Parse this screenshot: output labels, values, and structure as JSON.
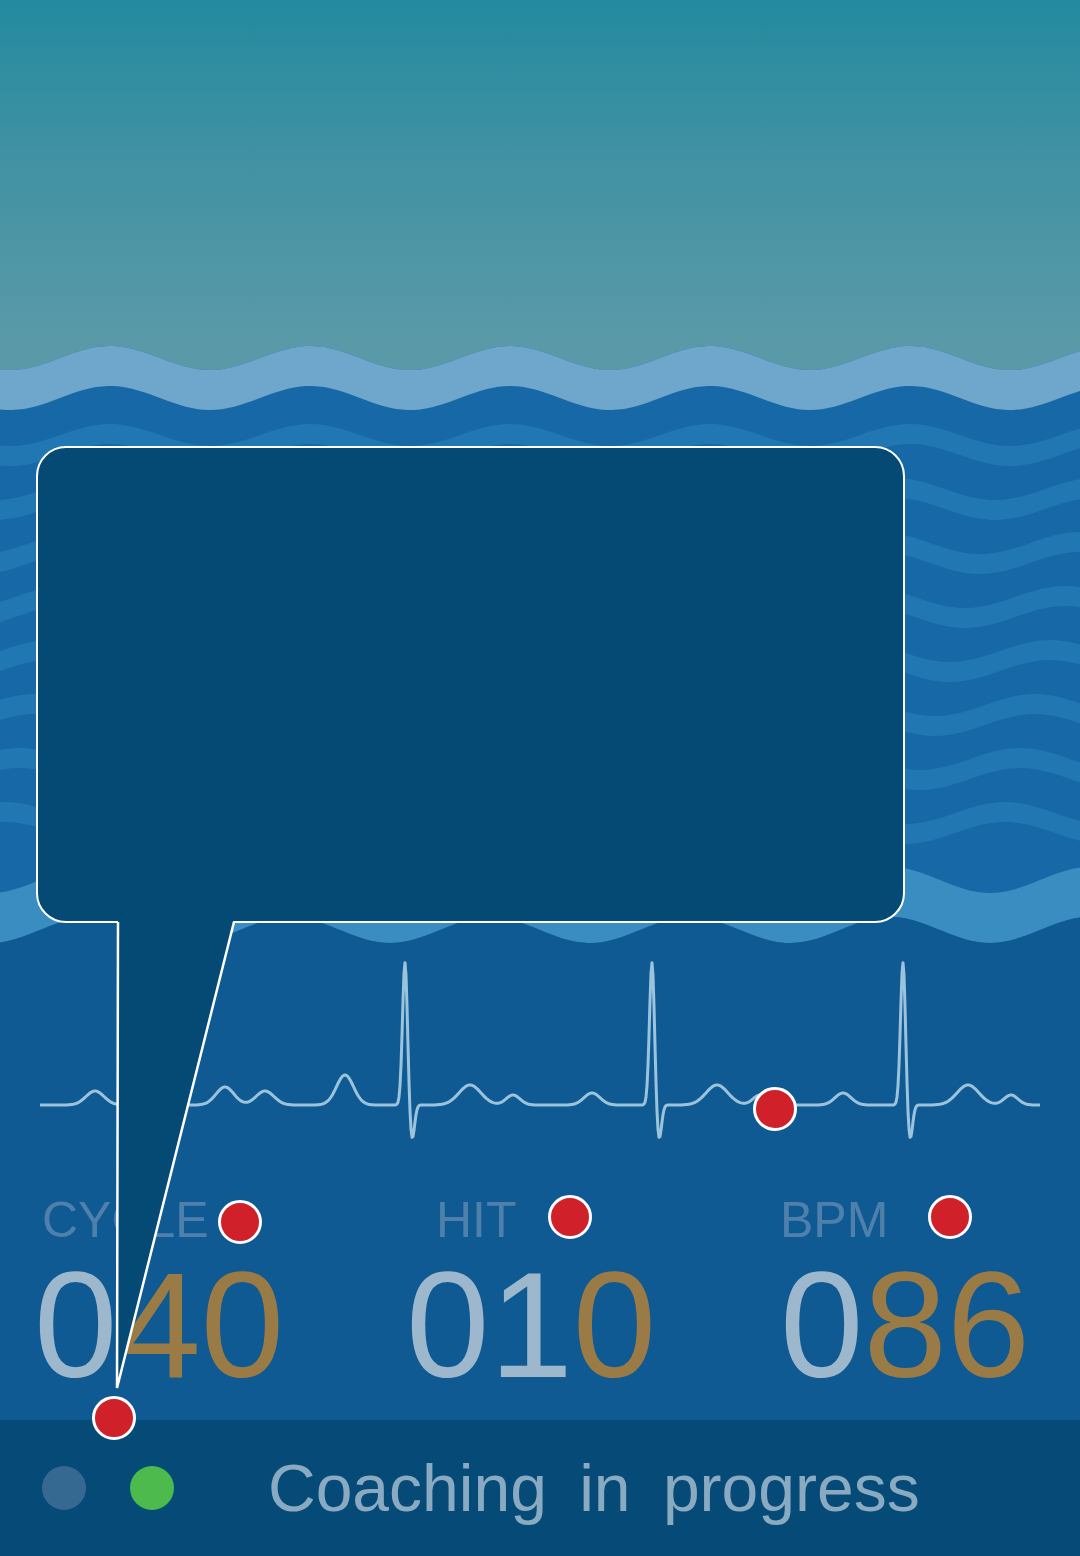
{
  "stats": [
    {
      "label": "CYCLE",
      "value_parts": [
        {
          "text": "0",
          "dim": true
        },
        {
          "text": "40",
          "dim": false
        }
      ]
    },
    {
      "label": "HIT",
      "value_parts": [
        {
          "text": "01",
          "dim": true
        },
        {
          "text": "0",
          "dim": false
        }
      ]
    },
    {
      "label": "BPM",
      "value_parts": [
        {
          "text": "0",
          "dim": true
        },
        {
          "text": "86",
          "dim": false
        }
      ]
    }
  ],
  "status_bar": {
    "indicators": [
      {
        "on": false,
        "color": "#3c6d95"
      },
      {
        "on": true,
        "color": "#4cba4c"
      }
    ],
    "text": "Coaching in progress"
  }
}
